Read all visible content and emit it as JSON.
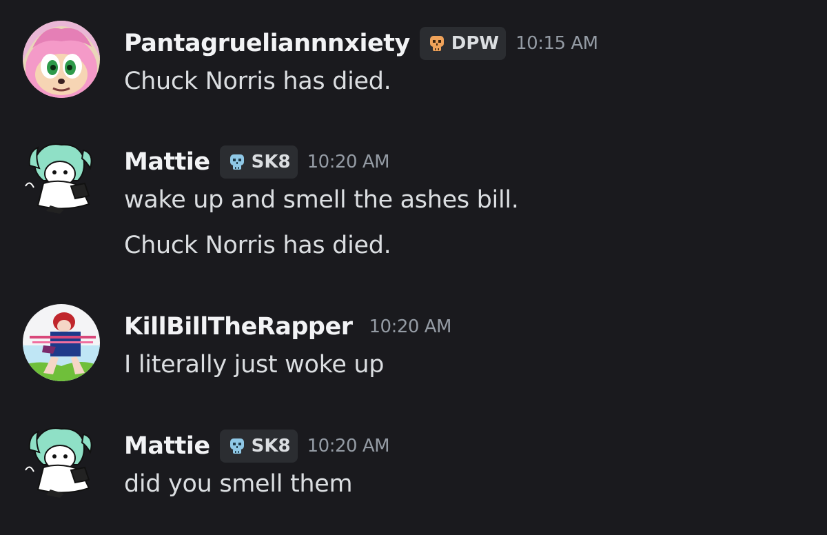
{
  "messages": [
    {
      "author": "Pantagrueliannnxiety",
      "tag": {
        "label": "DPW",
        "icon": "orange-skull-icon",
        "color": "#f0a35a"
      },
      "timestamp": "10:15 AM",
      "avatar": "pink-hedgehog-avatar",
      "lines": [
        "Chuck Norris has died."
      ]
    },
    {
      "author": "Mattie",
      "tag": {
        "label": "SK8",
        "icon": "blue-skull-icon",
        "color": "#8fc8e6"
      },
      "timestamp": "10:20 AM",
      "avatar": "mint-hair-sketch-avatar",
      "lines": [
        "wake up and smell the ashes bill.",
        "Chuck Norris has died."
      ]
    },
    {
      "author": "KillBillTheRapper",
      "timestamp": "10:20 AM",
      "avatar": "red-hair-girl-avatar",
      "lines": [
        "I literally just woke up"
      ]
    },
    {
      "author": "Mattie",
      "tag": {
        "label": "SK8",
        "icon": "blue-skull-icon",
        "color": "#8fc8e6"
      },
      "timestamp": "10:20 AM",
      "avatar": "mint-hair-sketch-avatar",
      "lines": [
        "did you smell them"
      ]
    }
  ]
}
